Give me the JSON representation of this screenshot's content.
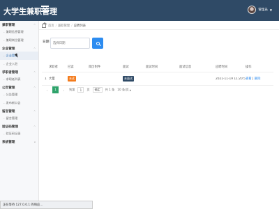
{
  "header": {
    "title": "大学生兼职管理",
    "username": "管理员"
  },
  "sidebar": {
    "groups": [
      {
        "label": "兼职管理",
        "items": [
          "兼职信息管理",
          "兼职岗位管理"
        ]
      },
      {
        "label": "企业管理",
        "items": [
          "企业管理",
          "企业入驻"
        ]
      },
      {
        "label": "求职者管理",
        "items": [
          "求职者列表"
        ]
      },
      {
        "label": "公告管理",
        "items": [
          "公告管理",
          "发布新公告"
        ]
      },
      {
        "label": "留言管理",
        "items": [
          "留言管理"
        ]
      },
      {
        "label": "验证码管理",
        "items": [
          "验证码记录"
        ]
      },
      {
        "label": "系统管理",
        "items": []
      }
    ],
    "active_item": "企业管理"
  },
  "breadcrumb": {
    "items": [
      "首页",
      "兼职管理",
      "应聘列表"
    ]
  },
  "search": {
    "label": "日期",
    "placeholder": "选择日期"
  },
  "table": {
    "headers": [
      "",
      "求职者",
      "已读",
      "简历附件",
      "面试",
      "面试时间",
      "面试信息",
      "应聘时间",
      "操作"
    ],
    "rows": [
      {
        "index": "1",
        "applicant": "大璽",
        "read": "未读",
        "attachment": "",
        "interview": "未面试",
        "interview_time": "",
        "interview_info": "",
        "apply_time": "2021-11-19 11:20:59",
        "action_view": "查看",
        "action_sep": "|",
        "action_delete": "删除"
      }
    ]
  },
  "pagination": {
    "prev": "‹",
    "current": "1",
    "next": "›",
    "goto_prefix": "到第",
    "goto_value": "1",
    "goto_suffix": "页",
    "confirm": "确定",
    "total": "共 1 条",
    "per_page": "10 条/页"
  },
  "statusbar": {
    "text": "正在等待 127.0.0.1 的响应..."
  },
  "colors": {
    "header_bg": "#2f4a66",
    "primary": "#2d8cf0",
    "page_active": "#2fa36b",
    "unread_badge": "#f37b1d"
  }
}
